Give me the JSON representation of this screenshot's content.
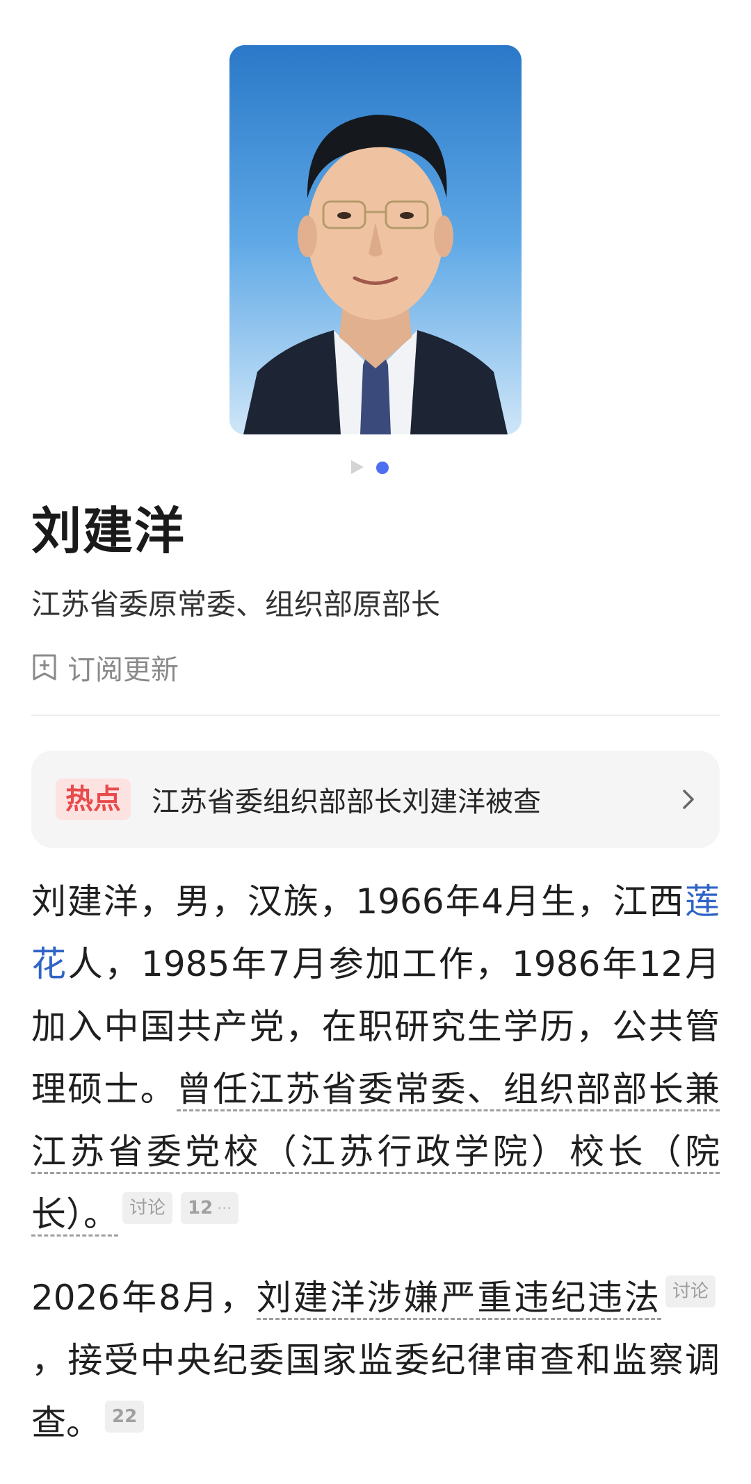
{
  "carousel": {
    "active_index": 1,
    "total": 2
  },
  "profile": {
    "name": "刘建洋",
    "subtitle": "江苏省委原常委、组织部原部长",
    "subscribe_label": "订阅更新"
  },
  "hot": {
    "badge": "热点",
    "text": "江苏省委组织部部长刘建洋被查"
  },
  "bio": {
    "p1_a": "刘建洋，男，汉族，1966年4月生，江西",
    "p1_link": "莲花",
    "p1_b": "人，1985年7月参加工作，1986年12月加入中国共产党，在职研究生学历，公共管理硕士。",
    "p1_c": "曾任江苏省委常委、组织部部长兼江苏省委党校（江苏行政学院）校长（院长）。",
    "p1_tag_discuss": "讨论",
    "p1_tag_count": "12",
    "p1_tag_more": "···",
    "p2_a": "2026年8月，",
    "p2_b": "刘建洋涉嫌严重违纪违法",
    "p2_tag_discuss": "讨论",
    "p2_c": "，接受中央纪委国家监委纪律审查和监察调查。",
    "p2_tag_count": "22"
  },
  "colors": {
    "accent": "#4e6ef2",
    "link": "#2f64c6",
    "hot_badge_bg": "#fde2e2",
    "hot_badge_text": "#e84b4b"
  }
}
